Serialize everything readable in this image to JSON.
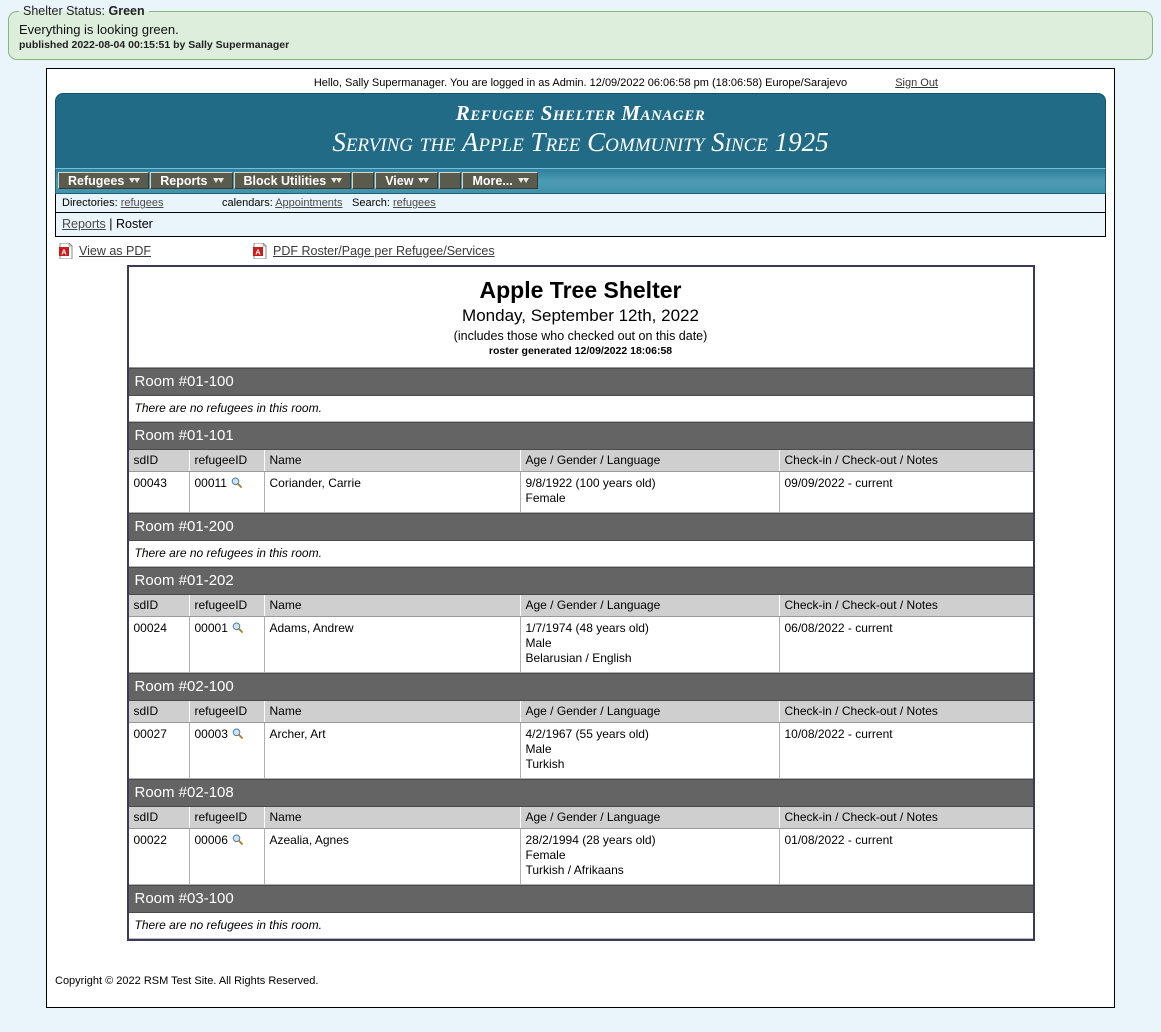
{
  "status": {
    "legend_label": "Shelter Status:",
    "legend_value": "Green",
    "message": "Everything is looking green.",
    "published": "published 2022-08-04 00:15:51 by Sally Supermanager",
    "bg_color": "#ddeedd",
    "border_color": "#86b686"
  },
  "loginbar": {
    "greeting": "Hello, Sally Supermanager. You are logged in as Admin. 12/09/2022 06:06:58 pm (18:06:58) Europe/Sarajevo",
    "sign_out": "Sign Out"
  },
  "banner": {
    "line1": "Refugee Shelter Manager",
    "line2": "Serving the Apple Tree Community Since 1925",
    "bg_color": "#216b86"
  },
  "menu": {
    "items": [
      {
        "label": "Refugees",
        "has_caret": true
      },
      {
        "label": "Reports",
        "has_caret": true
      },
      {
        "label": "Block Utilities",
        "has_caret": true
      },
      {
        "label": "",
        "has_caret": false
      },
      {
        "label": "View",
        "has_caret": true
      },
      {
        "label": "",
        "has_caret": false
      },
      {
        "label": "More...",
        "has_caret": true
      }
    ]
  },
  "dirbar": {
    "directories_label": "Directories:",
    "directories_link": "refugees",
    "calendars_label": "calendars:",
    "calendars_link": "Appointments",
    "search_label": "Search:",
    "search_link": "refugees"
  },
  "breadcrumb": {
    "parent": "Reports",
    "separator": "|",
    "current": "Roster"
  },
  "pdf_links": [
    {
      "label": "View as PDF",
      "icon": "pdf-icon"
    },
    {
      "label": "PDF Roster/Page per Refugee/Services",
      "icon": "pdf-icon"
    }
  ],
  "roster": {
    "title": "Apple Tree Shelter",
    "date": "Monday, September 12th, 2022",
    "note": "(includes those who checked out on this date)",
    "generated": "roster generated 12/09/2022 18:06:58",
    "empty_text": "There are no refugees in this room.",
    "columns": [
      "sdID",
      "refugeeID",
      "Name",
      "Age / Gender / Language",
      "Check-in / Check-out / Notes"
    ],
    "rooms": [
      {
        "name": "Room #01-100",
        "empty": true,
        "rows": []
      },
      {
        "name": "Room #01-101",
        "empty": false,
        "rows": [
          {
            "sdID": "00043",
            "refugeeID": "00011",
            "name": "Coriander, Carrie",
            "age": "9/8/1922 (100 years old)",
            "gender": "Female",
            "language": "",
            "checkin": "09/09/2022 - current"
          }
        ]
      },
      {
        "name": "Room #01-200",
        "empty": true,
        "rows": []
      },
      {
        "name": "Room #01-202",
        "empty": false,
        "rows": [
          {
            "sdID": "00024",
            "refugeeID": "00001",
            "name": "Adams, Andrew",
            "age": "1/7/1974 (48 years old)",
            "gender": "Male",
            "language": "Belarusian / English",
            "checkin": "06/08/2022 - current"
          }
        ]
      },
      {
        "name": "Room #02-100",
        "empty": false,
        "rows": [
          {
            "sdID": "00027",
            "refugeeID": "00003",
            "name": "Archer, Art",
            "age": "4/2/1967 (55 years old)",
            "gender": "Male",
            "language": "Turkish",
            "checkin": "10/08/2022 - current"
          }
        ]
      },
      {
        "name": "Room #02-108",
        "empty": false,
        "rows": [
          {
            "sdID": "00022",
            "refugeeID": "00006",
            "name": "Azealia, Agnes",
            "age": "28/2/1994 (28 years old)",
            "gender": "Female",
            "language": "Turkish / Afrikaans",
            "checkin": "01/08/2022 - current"
          }
        ]
      },
      {
        "name": "Room #03-100",
        "empty": true,
        "rows": []
      }
    ]
  },
  "footer": {
    "copyright": "Copyright © 2022 RSM Test Site. All Rights Reserved."
  }
}
